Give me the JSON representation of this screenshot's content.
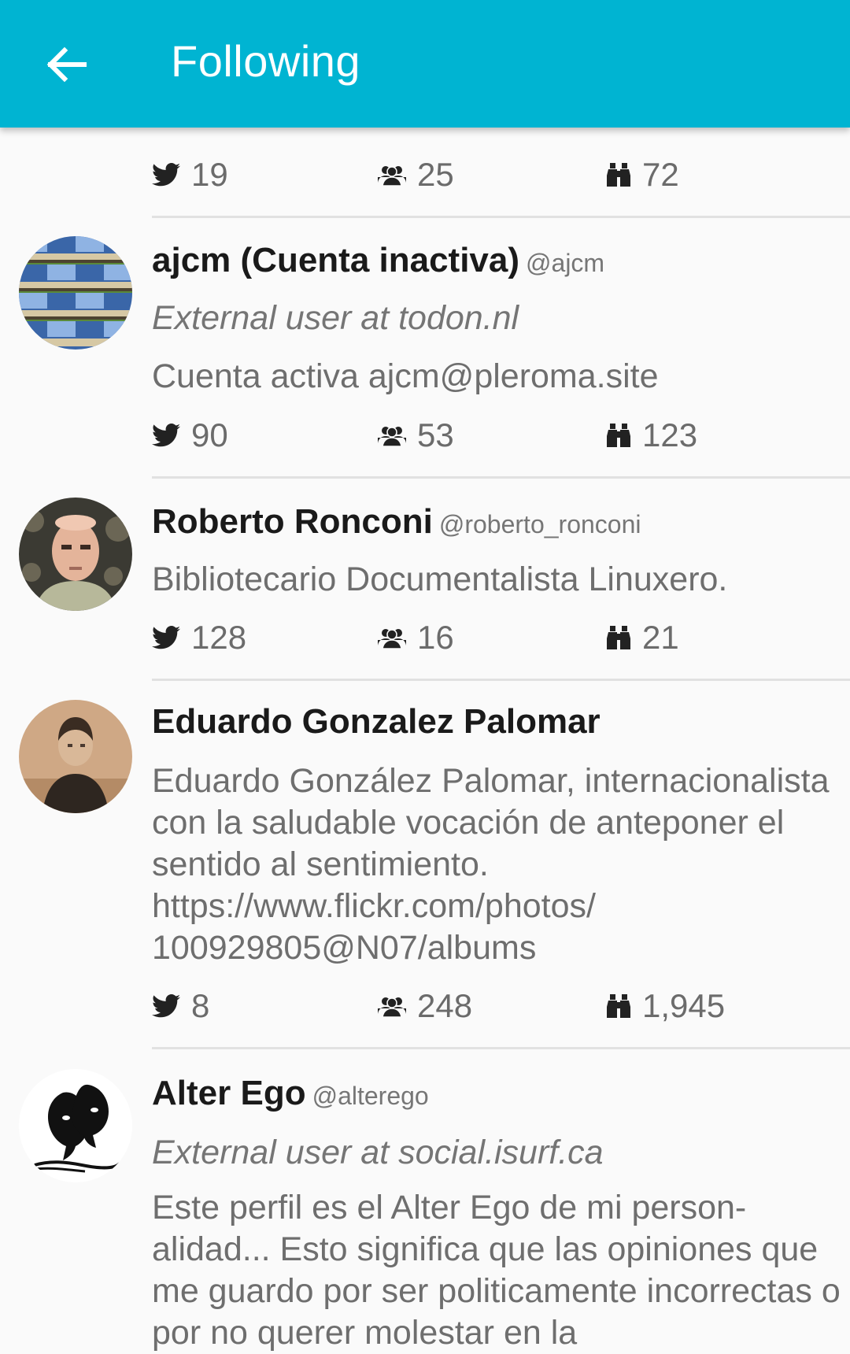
{
  "appbar": {
    "title": "Following",
    "back_icon": "arrow-left-icon",
    "color": "#00b4d2"
  },
  "stat_icons": [
    "twitter-bird-icon",
    "users-icon",
    "binoculars-icon"
  ],
  "users": [
    {
      "name": "",
      "handle": "",
      "external": "",
      "bio": "",
      "stats": {
        "posts": "19",
        "followers": "25",
        "following": "72"
      }
    },
    {
      "name": "ajcm (Cuenta inactiva)",
      "handle": "@ajcm",
      "external": "External user at todon.nl",
      "bio": "Cuenta activa ajcm@pleroma.site",
      "stats": {
        "posts": "90",
        "followers": "53",
        "following": "123"
      }
    },
    {
      "name": "Roberto Ronconi",
      "handle": "@roberto_ronconi",
      "bio": "Bibliotecario Documentalista Linuxero.",
      "stats": {
        "posts": "128",
        "followers": "16",
        "following": "21"
      }
    },
    {
      "name": "Eduardo Gonzalez Palomar",
      "handle": "",
      "bio": "Eduardo González Palomar, internacionalista con la saludable vocación de anteponer el sentido al sentimiento. https://www.flickr.com/photos/ 100929805@N07/albums",
      "stats": {
        "posts": "8",
        "followers": "248",
        "following": "1,945"
      }
    },
    {
      "name": "Alter Ego",
      "handle": "@alterego",
      "external": "External user at social.isurf.ca",
      "bio": "Este perfil es el Alter Ego de mi person- alidad... Esto significa que las opiniones que me guardo por ser politicamente incorrectas o por no querer molestar en la"
    }
  ]
}
